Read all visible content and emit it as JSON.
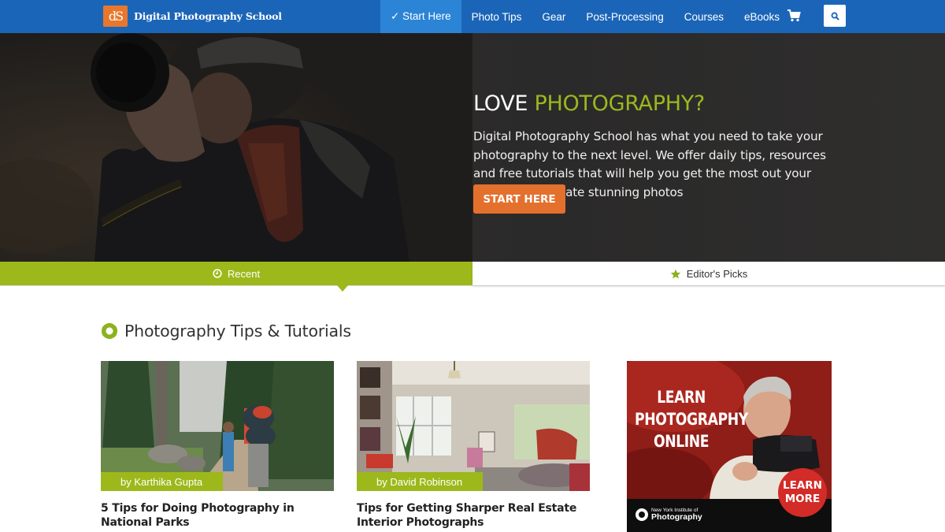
{
  "nav": {
    "logo_mark": "dS",
    "site_name": "Digital Photography School",
    "items": [
      {
        "label": "✓ Start Here",
        "active": true
      },
      {
        "label": "Photo Tips",
        "active": false
      },
      {
        "label": "Gear",
        "active": false
      },
      {
        "label": "Post-Processing",
        "active": false
      },
      {
        "label": "Courses",
        "active": false
      },
      {
        "label": "eBooks",
        "active": false
      }
    ],
    "cart_icon": "shopping-cart-icon",
    "search_icon": "search-icon"
  },
  "hero": {
    "title_white": "LOVE",
    "title_accent": "PHOTOGRAPHY?",
    "text": "Digital Photography School has what you need to take your photography to the next level. We offer daily tips, resources and free tutorials that will help you get the most out your camera and create stunning photos",
    "button": "START HERE"
  },
  "tabs": [
    {
      "label": "Recent",
      "icon": "clock-icon",
      "active": true
    },
    {
      "label": "Editor's Picks",
      "icon": "star-icon",
      "active": false
    }
  ],
  "section": {
    "title": "Photography Tips & Tutorials",
    "icon": "aperture-icon"
  },
  "articles": [
    {
      "author": "by Karthika Gupta",
      "title": "5 Tips for Doing Photography in National Parks"
    },
    {
      "author": "by David Robinson",
      "title": "Tips for Getting Sharper Real Estate Interior Photographs"
    }
  ],
  "ad": {
    "headline_lines": [
      "LEARN",
      "PHOTOGRAPHY",
      "ONLINE"
    ],
    "cta_lines": [
      "LEARN",
      "MORE"
    ],
    "brand_small": "New York Institute of",
    "brand_big": "Photography"
  },
  "colors": {
    "nav_bg": "#1b65b8",
    "nav_active": "#2b84d6",
    "accent_green": "#9db81a",
    "accent_orange": "#e4702d",
    "ad_red": "#d32b27"
  }
}
